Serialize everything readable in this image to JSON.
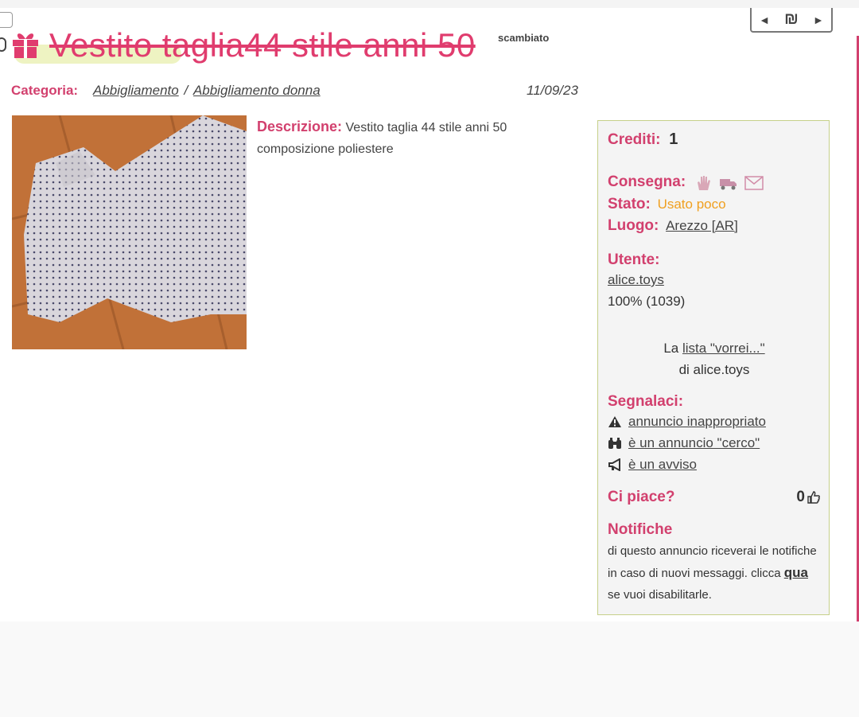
{
  "header": {
    "title": "Vestito taglia44 stile anni 50",
    "status_tag": "scambiato",
    "nav": {
      "prev_icon": "◄",
      "symbol": "₪",
      "next_icon": "►"
    }
  },
  "category": {
    "label": "Categoria:",
    "main": "Abbigliamento",
    "separator": "/",
    "sub": "Abbigliamento donna",
    "date": "11/09/23"
  },
  "description": {
    "label": "Descrizione:",
    "text": "Vestito taglia 44 stile anni 50 composizione poliestere"
  },
  "sidebar": {
    "credits_label": "Crediti:",
    "credits_value": "1",
    "delivery_label": "Consegna:",
    "delivery_icons": [
      "hand-icon",
      "truck-icon",
      "mail-icon"
    ],
    "state_label": "Stato:",
    "state_value": "Usato poco",
    "place_label": "Luogo:",
    "place_value": "Arezzo [AR]",
    "user_label": "Utente:",
    "user_name": "alice.toys",
    "user_rating": "100% (1039)",
    "wishlist_prefix": "La",
    "wishlist_link": "lista \"vorrei...\"",
    "wishlist_suffix": "di alice.toys",
    "report_label": "Segnalaci:",
    "report_items": [
      {
        "icon": "warning-icon",
        "label": "annuncio inappropriato"
      },
      {
        "icon": "binoculars-icon",
        "label": "è un annuncio \"cerco\""
      },
      {
        "icon": "megaphone-icon",
        "label": "è un avviso"
      }
    ],
    "like_label": "Ci piace?",
    "like_count": "0",
    "notif_label": "Notifiche",
    "notif_text_1": "di questo annuncio riceverai le notifiche in caso di nuovi messaggi. clicca",
    "notif_link": "qua",
    "notif_text_2": "se vuoi disabilitarle."
  },
  "colors": {
    "accent": "#d2406e",
    "state": "#f0a020",
    "panel_border": "#c6d08a"
  }
}
